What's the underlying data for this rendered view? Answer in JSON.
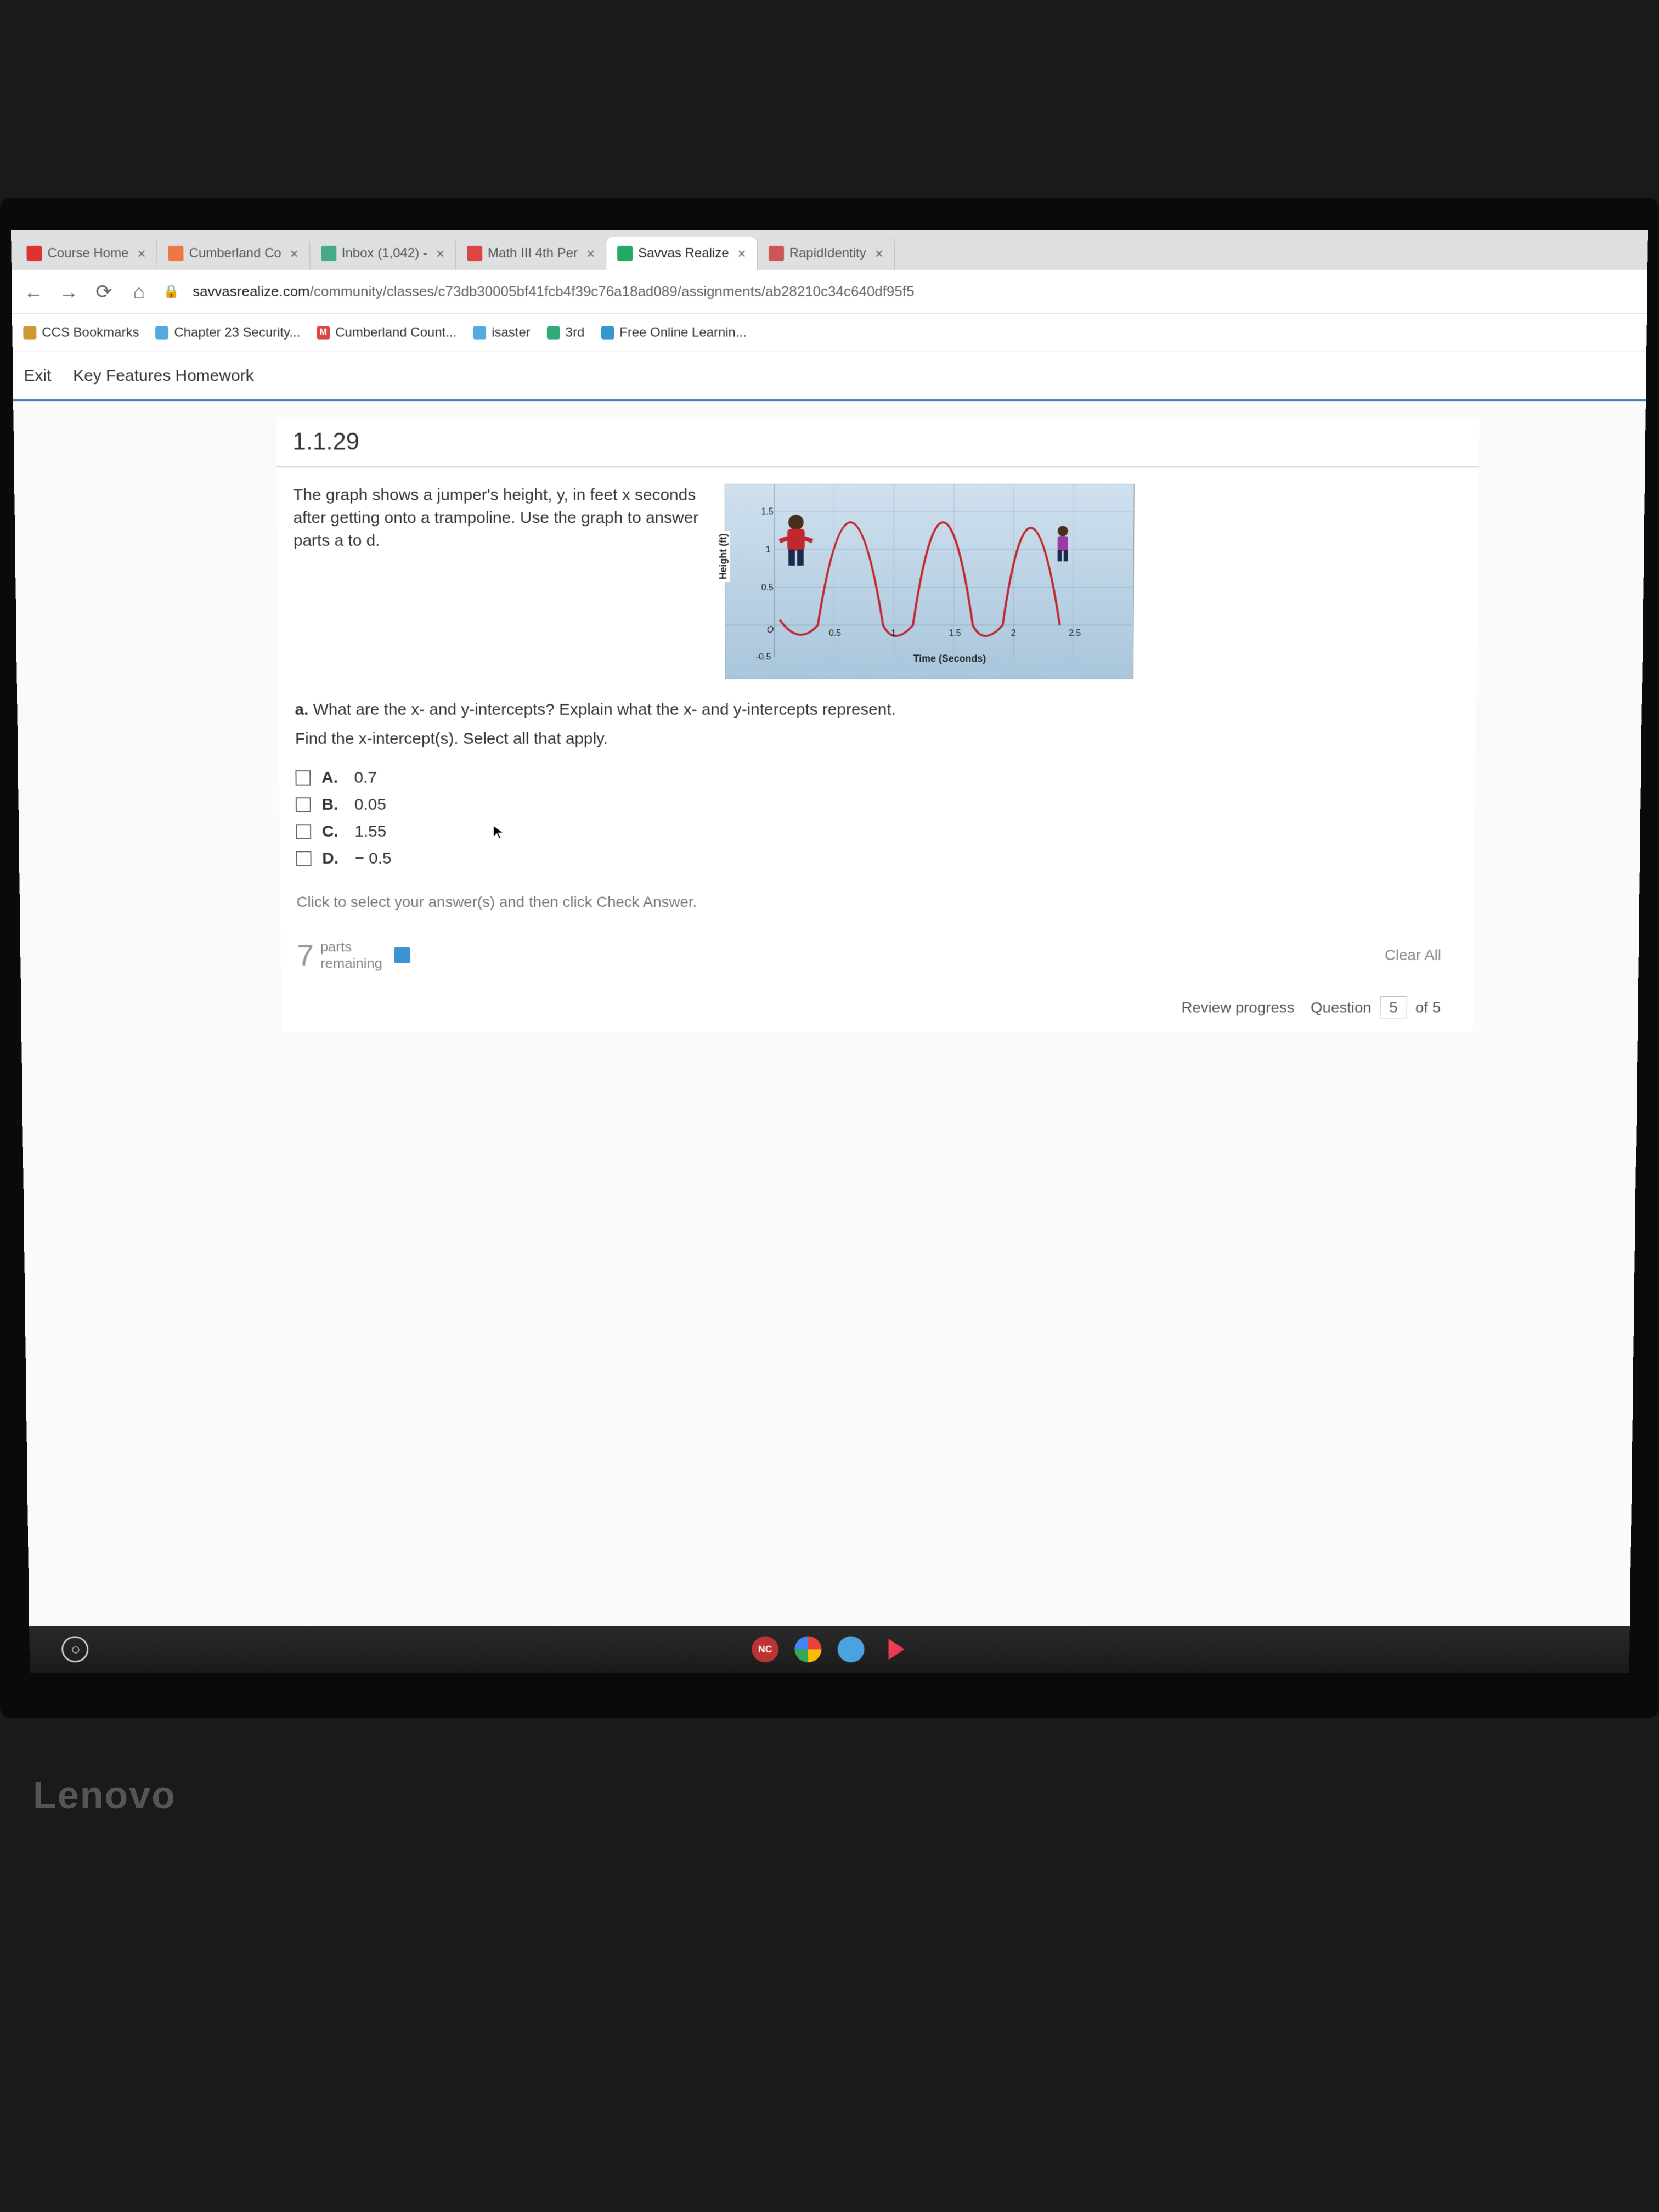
{
  "tabs": [
    {
      "label": "Course Home",
      "color": "#d33"
    },
    {
      "label": "Cumberland Co",
      "color": "#e74"
    },
    {
      "label": "Inbox (1,042) -",
      "color": "#4a8"
    },
    {
      "label": "Math III 4th Per",
      "color": "#d44"
    },
    {
      "label": "Savvas Realize",
      "color": "#2a6",
      "active": true
    },
    {
      "label": "RapidIdentity",
      "color": "#c55"
    }
  ],
  "url_host": "savvasrealize.com",
  "url_path": "/community/classes/c73db30005bf41fcb4f39c76a18ad089/assignments/ab28210c34c640df95f5",
  "bookmarks": [
    {
      "label": "CCS Bookmarks",
      "color": "#c93"
    },
    {
      "label": "Chapter 23 Security...",
      "color": "#5ad"
    },
    {
      "label": "Cumberland Count...",
      "color": "#d44",
      "letter": "M"
    },
    {
      "label": "isaster",
      "color": "#5ad"
    },
    {
      "label": "3rd",
      "color": "#3a7"
    },
    {
      "label": "Free Online Learnin...",
      "color": "#39c"
    }
  ],
  "app": {
    "exit": "Exit",
    "title": "Key Features Homework"
  },
  "problem": {
    "number": "1.1.29",
    "prompt": "The graph shows a jumper's height, y, in feet x seconds after getting onto a trampoline. Use the graph to answer parts a to d.",
    "graph": {
      "ylabel": "Height (ft)",
      "xlabel": "Time (Seconds)",
      "yticks": [
        "1.5",
        "1",
        "0.5",
        "-0.5"
      ],
      "xticks": [
        "0.5",
        "1",
        "1.5",
        "2",
        "2.5"
      ],
      "origin": "O"
    },
    "part_a_label": "a.",
    "part_a_text": "What are the x- and y-intercepts? Explain what the x- and y-intercepts represent.",
    "subquestion": "Find the x-intercept(s). Select all that apply.",
    "options": [
      {
        "letter": "A.",
        "value": "0.7"
      },
      {
        "letter": "B.",
        "value": "0.05"
      },
      {
        "letter": "C.",
        "value": "1.55"
      },
      {
        "letter": "D.",
        "value": "− 0.5"
      }
    ],
    "instruction": "Click to select your answer(s) and then click Check Answer.",
    "parts_number": "7",
    "parts_word_top": "parts",
    "parts_word_bot": "remaining",
    "clear_all": "Clear All",
    "review": "Review progress",
    "question_label": "Question",
    "question_num": "5",
    "question_of": "of 5"
  },
  "brand": "Lenovo"
}
